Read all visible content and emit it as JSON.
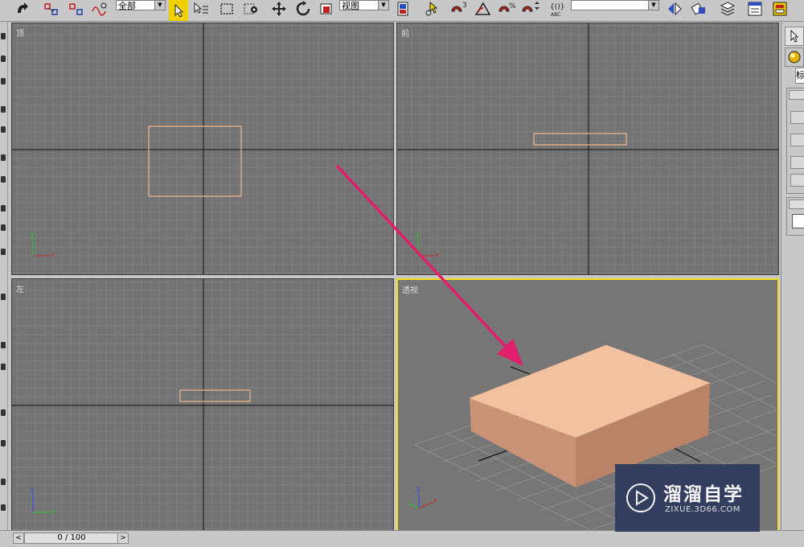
{
  "toolbar": {
    "selection_filter": "全部",
    "reference_coord": "视图",
    "named_selection": ""
  },
  "viewports": {
    "top": {
      "label": "顶"
    },
    "front": {
      "label": "前"
    },
    "left": {
      "label": "左"
    },
    "perspective": {
      "label": "透视"
    }
  },
  "panel": {
    "tab_label": "标"
  },
  "timeline": {
    "frame_display": "0 / 100",
    "prev_label": "<",
    "next_label": ">"
  },
  "watermark": {
    "title": "溜溜自学",
    "subtitle": "ZIXUE.3D66.COM"
  },
  "colors": {
    "viewport_bg": "#737373",
    "object_color": "#f0c0a0",
    "active_border": "#f0e020",
    "annotation_arrow": "#e0206a",
    "watermark_bg": "#2f3a5c"
  }
}
